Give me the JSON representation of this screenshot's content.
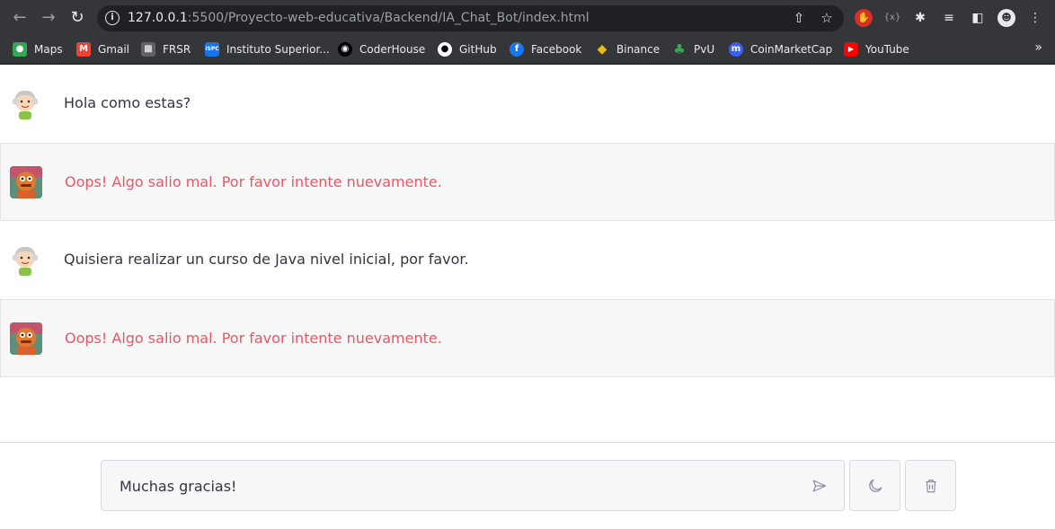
{
  "browser": {
    "url_host": "127.0.0.1",
    "url_rest": ":5500/Proyecto-web-educativa/Backend/IA_Chat_Bot/index.html",
    "bookmarks": [
      {
        "label": "Maps",
        "icon": "maps-icon",
        "color": "#34a853"
      },
      {
        "label": "Gmail",
        "icon": "gmail-icon",
        "color": "#ea4335"
      },
      {
        "label": "FRSR",
        "icon": "frsr-icon",
        "color": "#5f6368"
      },
      {
        "label": "Instituto Superior...",
        "icon": "ispc-icon",
        "color": "#1a73e8"
      },
      {
        "label": "CoderHouse",
        "icon": "coderhouse-icon",
        "color": "#000000"
      },
      {
        "label": "GitHub",
        "icon": "github-icon",
        "color": "#ffffff"
      },
      {
        "label": "Facebook",
        "icon": "facebook-icon",
        "color": "#1877f2"
      },
      {
        "label": "Binance",
        "icon": "binance-icon",
        "color": "#f0b90b"
      },
      {
        "label": "PvU",
        "icon": "pvu-icon",
        "color": "#34a853"
      },
      {
        "label": "CoinMarketCap",
        "icon": "coinmarketcap-icon",
        "color": "#3861fb"
      },
      {
        "label": "YouTube",
        "icon": "youtube-icon",
        "color": "#ff0000"
      }
    ]
  },
  "chat": {
    "messages": [
      {
        "role": "user",
        "text": "Hola como estas?"
      },
      {
        "role": "bot",
        "text": "Oops! Algo salio mal. Por favor intente nuevamente."
      },
      {
        "role": "user",
        "text": "Quisiera realizar un curso de Java nivel inicial, por favor."
      },
      {
        "role": "bot",
        "text": "Oops! Algo salio mal. Por favor intente nuevamente."
      }
    ],
    "input_value": "Muchas gracias!",
    "error_color": "#e55865"
  }
}
